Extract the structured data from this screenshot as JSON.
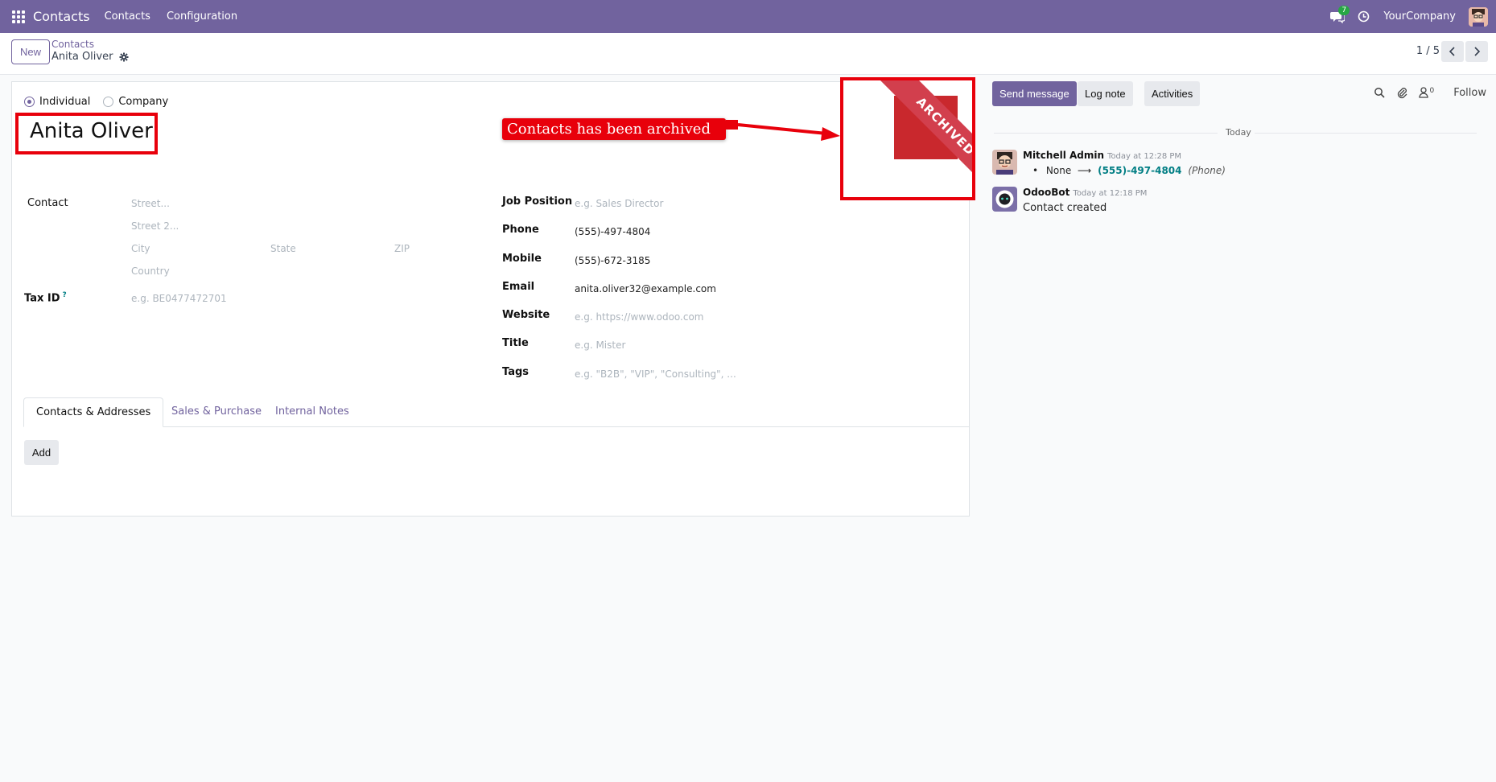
{
  "navbar": {
    "brand": "Contacts",
    "menu": [
      "Contacts",
      "Configuration"
    ],
    "chat_count": "7",
    "company": "YourCompany"
  },
  "control": {
    "new_label": "New",
    "breadcrumb": "Contacts",
    "record": "Anita Oliver",
    "pager": "1 / 5"
  },
  "form": {
    "type_individual": "Individual",
    "type_company": "Company",
    "name": "Anita Oliver",
    "callout": "Contacts has been archived",
    "ribbon": "ARCHIVED",
    "contact_label": "Contact",
    "street_ph": "Street...",
    "street2_ph": "Street 2...",
    "city_ph": "City",
    "state_ph": "State",
    "zip_ph": "ZIP",
    "country_ph": "Country",
    "taxid_label": "Tax ID",
    "taxid_help": "?",
    "taxid_ph": "e.g. BE0477472701",
    "job_label": "Job Position",
    "job_ph": "e.g. Sales Director",
    "phone_label": "Phone",
    "phone": "(555)-497-4804",
    "mobile_label": "Mobile",
    "mobile": "(555)-672-3185",
    "email_label": "Email",
    "email": "anita.oliver32@example.com",
    "website_label": "Website",
    "website_ph": "e.g. https://www.odoo.com",
    "title_label": "Title",
    "title_ph": "e.g. Mister",
    "tags_label": "Tags",
    "tags_ph": "e.g. \"B2B\", \"VIP\", \"Consulting\", ...",
    "tabs": [
      "Contacts & Addresses",
      "Sales & Purchase",
      "Internal Notes"
    ],
    "add_label": "Add"
  },
  "chatter": {
    "send_message": "Send message",
    "log_note": "Log note",
    "activities": "Activities",
    "followers_count": "0",
    "follow": "Follow",
    "day": "Today",
    "messages": [
      {
        "author": "Mitchell Admin",
        "time": "Today at 12:28 PM",
        "old": "None",
        "arrow": "⟶",
        "new": "(555)-497-4804",
        "field": "(Phone)"
      },
      {
        "author": "OdooBot",
        "time": "Today at 12:18 PM",
        "body": "Contact created"
      }
    ]
  }
}
